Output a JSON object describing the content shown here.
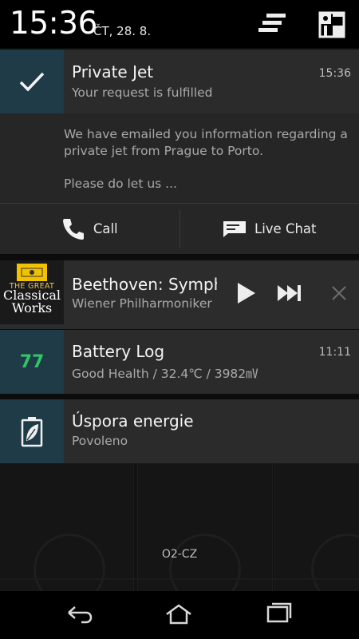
{
  "status": {
    "time": "15:36",
    "date": "ČT, 28. 8."
  },
  "notifications": {
    "jet": {
      "title": "Private Jet",
      "subtitle": "Your request is fulfilled",
      "time": "15:36",
      "body1": "We have emailed you information regarding a private jet from Prague to Porto.",
      "body2": "Please do let us ...",
      "actions": {
        "call": "Call",
        "chat": "Live Chat"
      }
    },
    "music": {
      "title": "Beethoven: Symph",
      "artist": "Wiener Philharmoniker",
      "album_top": "THE GREAT",
      "album_title_1": "Classical",
      "album_title_2": "Works"
    },
    "battery": {
      "level": "77",
      "title": "Battery Log",
      "subtitle": "Good Health / 32.4℃ / 3982㎷",
      "time": "11:11"
    },
    "energy": {
      "title": "Úspora energie",
      "subtitle": "Povoleno"
    }
  },
  "carrier": "O2-CZ",
  "colors": {
    "icon_bg": "#1e3b47",
    "battery_green": "#33c466",
    "notif_bg": "#2b2b2b"
  }
}
